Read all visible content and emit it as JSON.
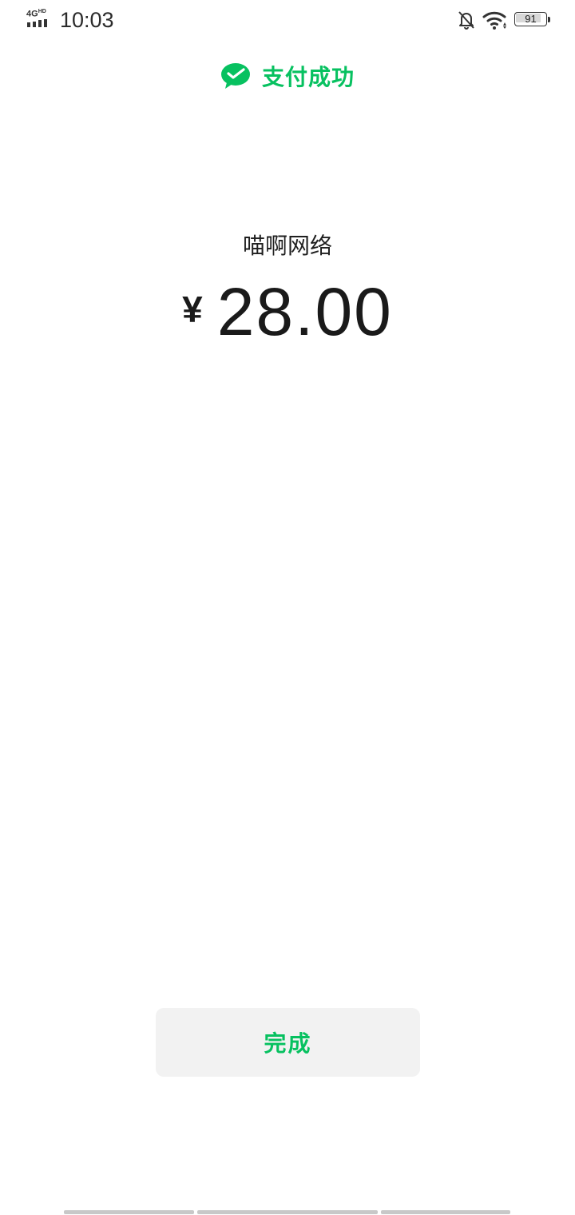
{
  "status_bar": {
    "network_type": "4G",
    "network_badge": "HD",
    "time": "10:03",
    "battery_level": "91",
    "icons": [
      "signal-icon",
      "bell-off-icon",
      "wifi-icon",
      "battery-icon"
    ]
  },
  "header": {
    "icon": "wechat-pay-icon",
    "title": "支付成功"
  },
  "payment": {
    "payee": "喵啊网络",
    "currency_symbol": "¥",
    "amount": "28.00"
  },
  "actions": {
    "done_label": "完成"
  },
  "colors": {
    "accent": "#07c160",
    "text": "#1a1a1a",
    "button_bg": "#f2f2f2",
    "background": "#ffffff"
  }
}
